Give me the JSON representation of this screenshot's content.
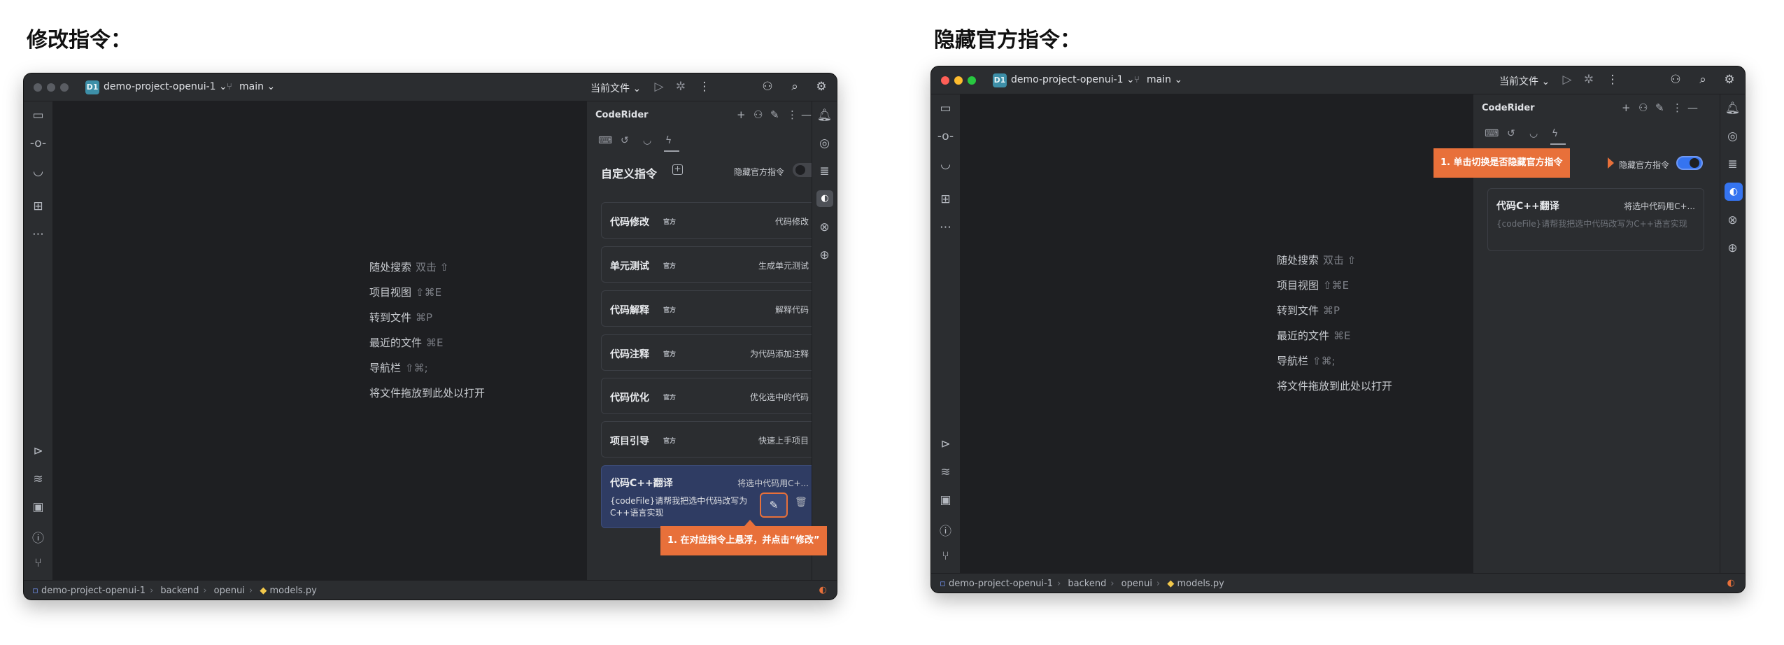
{
  "left_heading": "修改指令：",
  "right_heading": "隐藏官方指令：",
  "ide": {
    "project_badge": "D1",
    "project_name": "demo-project-openui-1",
    "branch": "main",
    "current_file": "当前文件",
    "panel_title": "CodeRider",
    "custom_title": "自定义指令",
    "hide_official_label": "隐藏官方指令",
    "hints": [
      {
        "label": "随处搜索",
        "key": "双击 ⇧"
      },
      {
        "label": "项目视图",
        "key": "⇧⌘E"
      },
      {
        "label": "转到文件",
        "key": "⌘P"
      },
      {
        "label": "最近的文件",
        "key": "⌘E"
      },
      {
        "label": "导航栏",
        "key": "⇧⌘;"
      },
      {
        "label": "将文件拖放到此处以打开",
        "key": ""
      }
    ],
    "breadcrumb": [
      "demo-project-openui-1",
      "backend",
      "openui",
      "models.py"
    ]
  },
  "left": {
    "hide_official_on": false,
    "commands": [
      {
        "name": "代码修改",
        "tag": "官方",
        "desc": "代码修改"
      },
      {
        "name": "单元测试",
        "tag": "官方",
        "desc": "生成单元测试"
      },
      {
        "name": "代码解释",
        "tag": "官方",
        "desc": "解释代码"
      },
      {
        "name": "代码注释",
        "tag": "官方",
        "desc": "为代码添加注释"
      },
      {
        "name": "代码优化",
        "tag": "官方",
        "desc": "优化选中的代码"
      },
      {
        "name": "项目引导",
        "tag": "官方",
        "desc": "快速上手项目"
      }
    ],
    "custom_command": {
      "name": "代码C++翻译",
      "desc": "将选中代码用C+...",
      "body": "{codeFile}请帮我把选中代码改写为C++语言实现"
    },
    "callout": "1. 在对应指令上悬浮，并点击“修改”"
  },
  "right": {
    "hide_official_on": true,
    "custom_command": {
      "name": "代码C++翻译",
      "desc": "将选中代码用C+...",
      "body": "{codeFile}请帮我把选中代码改写为C++语言实现"
    },
    "callout": "1. 单击切换是否隐藏官方指令"
  },
  "colors": {
    "accent_orange": "#e8703a",
    "toggle_on": "#3574f0",
    "ide_background": "#1e1f22",
    "panel_background": "#2b2d30",
    "hover_card": "#2f3c63"
  }
}
